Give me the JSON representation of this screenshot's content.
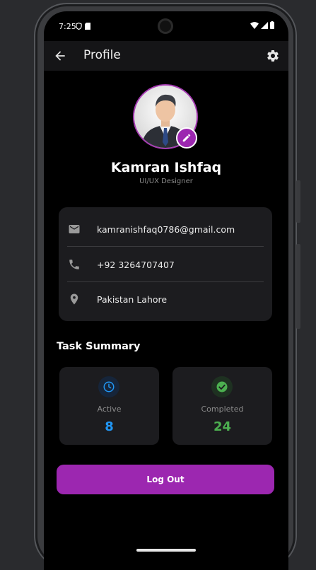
{
  "status_bar": {
    "time": "7:25"
  },
  "app_bar": {
    "title": "Profile"
  },
  "profile": {
    "name": "Kamran Ishfaq",
    "role": "UI/UX Designer"
  },
  "contact": {
    "email": "kamranishfaq0786@gmail.com",
    "phone": "+92 3264707407",
    "location": "Pakistan Lahore"
  },
  "task_summary": {
    "title": "Task Summary",
    "active": {
      "label": "Active",
      "count": "8",
      "color": "#2196f3"
    },
    "completed": {
      "label": "Completed",
      "count": "24",
      "color": "#4caf50"
    }
  },
  "actions": {
    "logout_label": "Log Out"
  },
  "colors": {
    "accent": "#9c27b0",
    "background": "#000000",
    "card": "#1c1c1f"
  },
  "icons": [
    "back-arrow-icon",
    "settings-gear-icon",
    "edit-pencil-icon",
    "email-icon",
    "phone-icon",
    "location-pin-icon",
    "clock-icon",
    "check-circle-icon"
  ]
}
